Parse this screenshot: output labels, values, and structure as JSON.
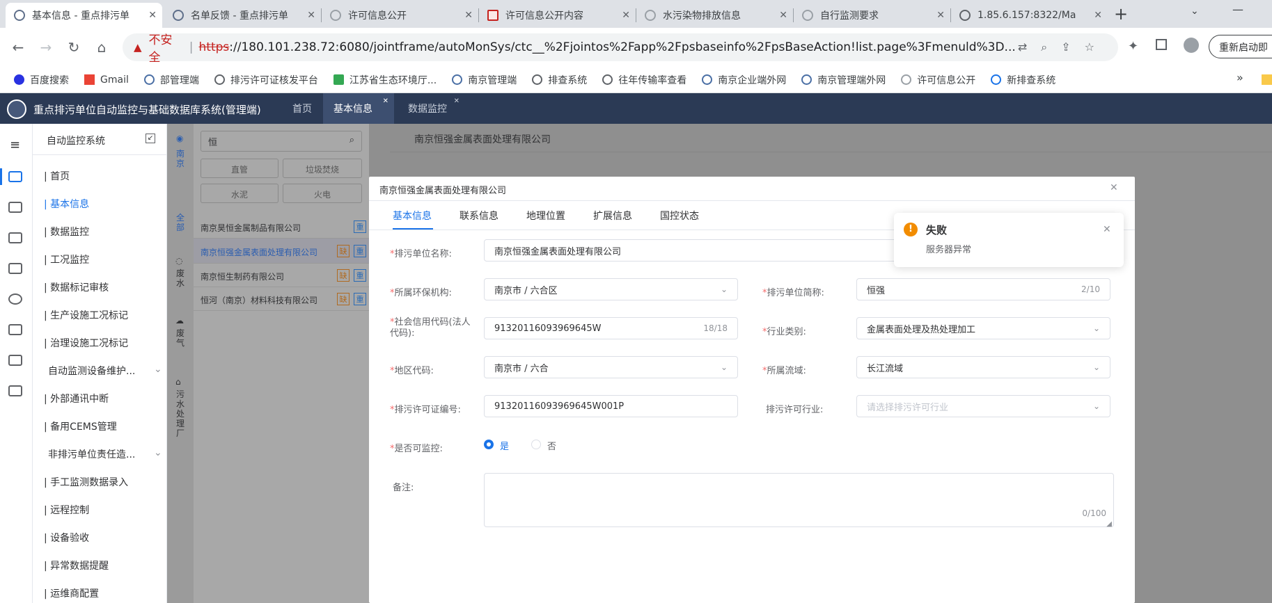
{
  "browser": {
    "tabs": [
      {
        "title": "基本信息 - 重点排污单",
        "active": true
      },
      {
        "title": "名单反馈 - 重点排污单",
        "active": false
      },
      {
        "title": "许可信息公开",
        "active": false
      },
      {
        "title": "许可信息公开内容",
        "active": false
      },
      {
        "title": "水污染物排放信息",
        "active": false
      },
      {
        "title": "自行监测要求",
        "active": false
      },
      {
        "title": "1.85.6.157:8322/Ma",
        "active": false
      }
    ],
    "new_tab": "+",
    "insecure_label": "不安全",
    "url_scheme": "https",
    "url_rest": "://180.101.238.72:6080/jointframe/autoMonSys/ctc__%2Fjointos%2Fapp%2Fpsbaseinfo%2FpsBaseAction!list.page%3Fmenuld%3D...",
    "restart_button": "重新启动即",
    "bookmarks": [
      "百度搜索",
      "Gmail",
      "部管理端",
      "排污许可证核发平台",
      "江苏省生态环境厅...",
      "南京管理端",
      "排查系统",
      "往年传输率查看",
      "南京企业端外网",
      "南京管理端外网",
      "许可信息公开",
      "新排查系统"
    ],
    "bookmarks_more": "»"
  },
  "app": {
    "title": "重点排污单位自动监控与基础数据库系统(管理端)",
    "tabs": [
      {
        "label": "首页",
        "closable": false
      },
      {
        "label": "基本信息",
        "closable": true
      },
      {
        "label": "数据监控",
        "closable": true
      }
    ]
  },
  "menu": {
    "title": "自动监控系统",
    "items": [
      "首页",
      "基本信息",
      "数据监控",
      "工况监控",
      "数据标记审核",
      "生产设施工况标记",
      "治理设施工况标记",
      "自动监测设备维护...",
      "外部通讯中断",
      "备用CEMS管理",
      "非排污单位责任造...",
      "手工监测数据录入",
      "远程控制",
      "设备验收",
      "异常数据提醒",
      "运维商配置"
    ]
  },
  "tree": {
    "region": "南京",
    "search_value": "恒",
    "filters": [
      "直管",
      "垃圾焚烧",
      "水泥",
      "火电"
    ],
    "categories": [
      "全部",
      "废水",
      "废气",
      "污水处理厂"
    ],
    "companies": [
      {
        "name": "南京昊恒金属制品有限公司",
        "badges": [
          "重"
        ]
      },
      {
        "name": "南京恒强金属表面处理有限公司",
        "badges": [
          "缺",
          "重"
        ]
      },
      {
        "name": "南京恒生制药有限公司",
        "badges": [
          "缺",
          "重"
        ]
      },
      {
        "name": "恒河（南京）材料科技有限公司",
        "badges": [
          "缺",
          "重"
        ]
      }
    ]
  },
  "main": {
    "header": "南京恒强金属表面处理有限公司"
  },
  "dialog": {
    "title": "南京恒强金属表面处理有限公司",
    "tabs": [
      "基本信息",
      "联系信息",
      "地理位置",
      "扩展信息",
      "国控状态"
    ],
    "fields": {
      "unit_name": {
        "label": "排污单位名称:",
        "value": "南京恒强金属表面处理有限公司"
      },
      "env_org": {
        "label": "所属环保机构:",
        "value": "南京市 / 六合区"
      },
      "short_name": {
        "label": "排污单位简称:",
        "value": "恒强",
        "count": "2/10"
      },
      "credit_code": {
        "label": "社会信用代码(法人代码):",
        "value": "91320116093969645W",
        "count": "18/18"
      },
      "industry": {
        "label": "行业类别:",
        "value": "金属表面处理及热处理加工"
      },
      "region_code": {
        "label": "地区代码:",
        "value": "南京市 / 六合"
      },
      "basin": {
        "label": "所属流域:",
        "value": "长江流域"
      },
      "permit_no": {
        "label": "排污许可证编号:",
        "value": "91320116093969645W001P"
      },
      "permit_industry": {
        "label": "排污许可行业:",
        "placeholder": "请选择排污许可行业"
      },
      "monitorable": {
        "label": "是否可监控:",
        "yes": "是",
        "no": "否"
      },
      "remark": {
        "label": "备注:",
        "count": "0/100"
      }
    }
  },
  "toast": {
    "title": "失败",
    "message": "服务器异常"
  },
  "colors": {
    "app_header": "#2b3a55",
    "primary": "#1a73e8",
    "error": "#f56c6c",
    "warning_icon": "#f28c00",
    "badge_orange": "#e6a23c",
    "badge_blue": "#409eff"
  }
}
